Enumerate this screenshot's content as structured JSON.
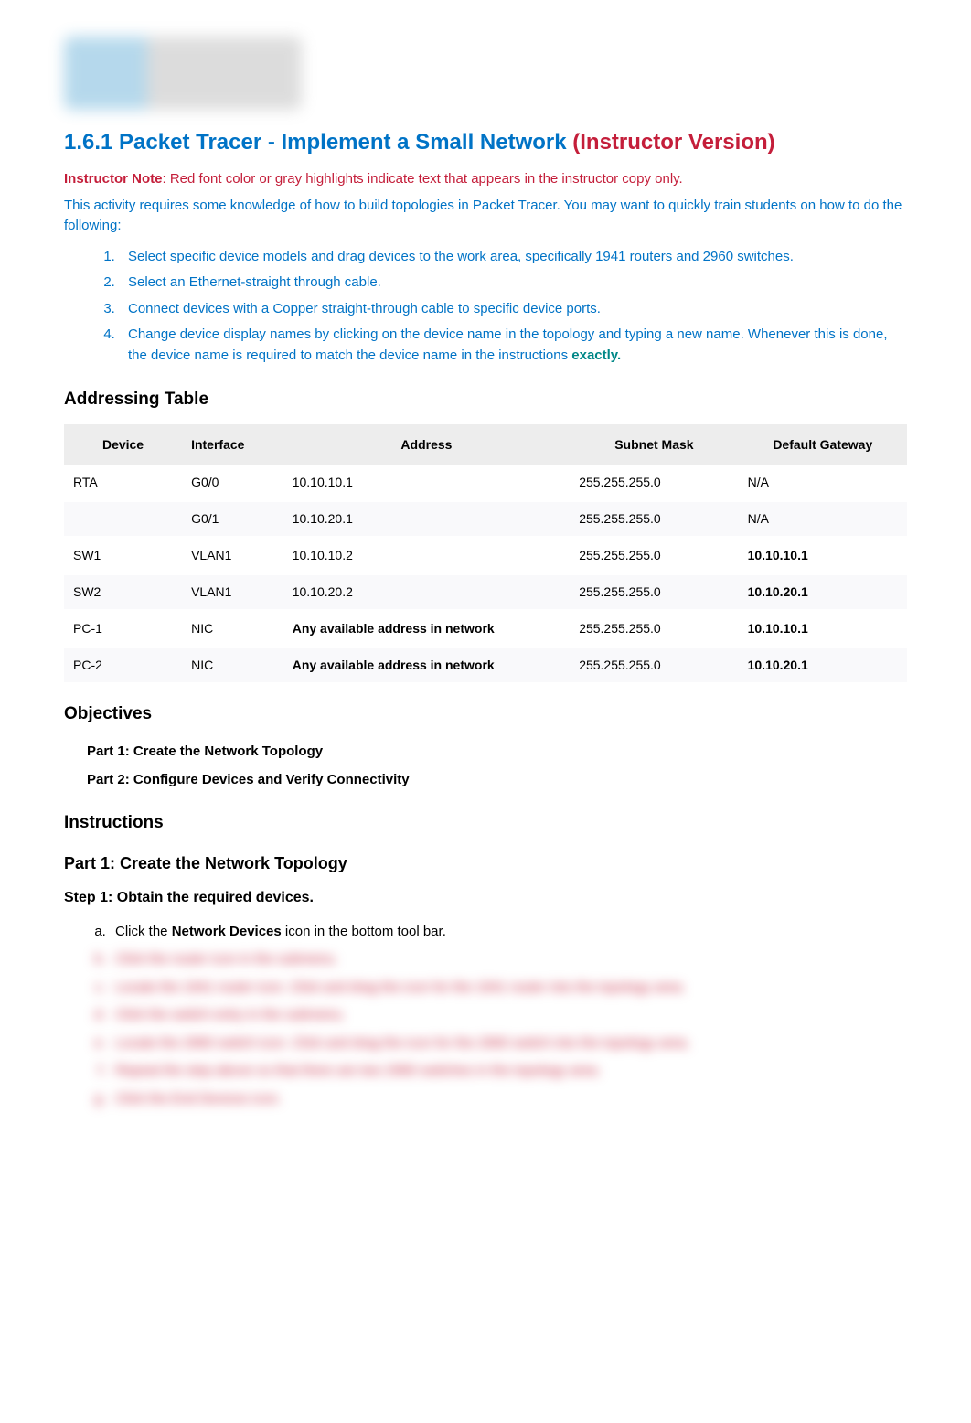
{
  "header": {
    "title_link": "1.6.1 Packet Tracer - Implement a Small Network",
    "title_suffix": "(Instructor Version)"
  },
  "instructor_note_label": "Instructor Note",
  "instructor_note_text": ": Red font color or gray highlights indicate text that appears in the instructor copy only.",
  "intro": "This activity requires some knowledge of how to build topologies in Packet Tracer. You may want to quickly train students on how to do the following:",
  "guide": [
    {
      "text": "Select specific device models and drag devices to the work area, specifically 1941 routers and 2960 switches."
    },
    {
      "text": "Select an Ethernet-straight through cable."
    },
    {
      "text": "Connect devices with a Copper straight-through cable to specific device ports."
    },
    {
      "text_a": "Change device display names by clicking on the device name in the topology and typing a new name. Whenever this is done, the device name is required to match the device name in the instructions ",
      "text_b": "exactly."
    }
  ],
  "addressing_heading": "Addressing Table",
  "table": {
    "headers": [
      "Device",
      "Interface",
      "Address",
      "Subnet Mask",
      "Default Gateway"
    ],
    "rows": [
      {
        "device": "RTA",
        "interface": "G0/0",
        "address": "10.10.10.1",
        "address_bold": false,
        "mask": "255.255.255.0",
        "gw": "N/A",
        "gw_bold": false
      },
      {
        "device": "",
        "interface": "G0/1",
        "address": "10.10.20.1",
        "address_bold": false,
        "mask": "255.255.255.0",
        "gw": "N/A",
        "gw_bold": false
      },
      {
        "device": "SW1",
        "interface": "VLAN1",
        "address": "10.10.10.2",
        "address_bold": false,
        "mask": "255.255.255.0",
        "gw": "10.10.10.1",
        "gw_bold": true
      },
      {
        "device": "SW2",
        "interface": "VLAN1",
        "address": "10.10.20.2",
        "address_bold": false,
        "mask": "255.255.255.0",
        "gw": "10.10.20.1",
        "gw_bold": true
      },
      {
        "device": "PC-1",
        "interface": "NIC",
        "address": "Any available address in network",
        "address_bold": true,
        "mask": "255.255.255.0",
        "gw": "10.10.10.1",
        "gw_bold": true
      },
      {
        "device": "PC-2",
        "interface": "NIC",
        "address": "Any available address in network",
        "address_bold": true,
        "mask": "255.255.255.0",
        "gw": "10.10.20.1",
        "gw_bold": true
      }
    ]
  },
  "objectives_heading": "Objectives",
  "objectives": [
    "Part 1: Create the Network Topology",
    "Part 2: Configure Devices and Verify Connectivity"
  ],
  "instructions_heading": "Instructions",
  "part1_heading": "Part 1: Create the Network Topology",
  "step1_heading": "Step 1: Obtain the required devices.",
  "step1_a_prefix": "Click  the ",
  "step1_a_bold": "Network Devices",
  "step1_a_suffix": " icon in the bottom tool bar.",
  "blurred_steps": [
    "Click the router icon in the submenu.",
    "Locate the 1941 router icon. Click and drag the icon for the 1941 router into the topology area.",
    "Click the switch entry in the submenu.",
    "Locate the 2960 switch icon. Click and drag the icon for the 2960 switch into the topology area.",
    "Repeat the step above so that there are two 2960 switches in the topology area.",
    "Click the End Devices icon."
  ]
}
